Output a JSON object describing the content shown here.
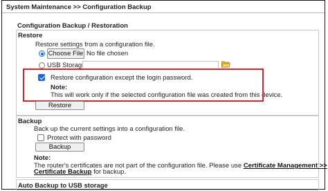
{
  "header": {
    "title": "System Maintenance >> Configuration Backup"
  },
  "section": {
    "title": "Configuration Backup / Restoration"
  },
  "restore": {
    "heading": "Restore",
    "description": "Restore settings from a configuration file.",
    "choose_file_label": "Choose File",
    "no_file_text": "No file chosen",
    "usb_storage_label": "USB Storage",
    "usb_storage_value": "",
    "except_login_label": "Restore configuration except the login password.",
    "note_title": "Note:",
    "note_text": "This will work only if the selected configuration file was created from this device.",
    "restore_button": "Restore"
  },
  "backup": {
    "heading": "Backup",
    "description": "Back up the current settings into a configuration file.",
    "protect_label": "Protect with password",
    "backup_button": "Backup",
    "note_title": "Note:",
    "note_text_1": "The router's certificates are not part of the configuration file. Please use",
    "link_cert_mgmt": "Certificate Management >>",
    "link_cert_backup": "Certificate Backup",
    "note_text_2": "for backup."
  },
  "auto_backup": {
    "heading": "Auto Backup to USB storage"
  },
  "state": {
    "restore_source": "file",
    "except_login_checked": true,
    "protect_checked": false
  },
  "colors": {
    "highlight": "#d8232a",
    "accent": "#1a66d8",
    "folder": "#e8b830"
  }
}
